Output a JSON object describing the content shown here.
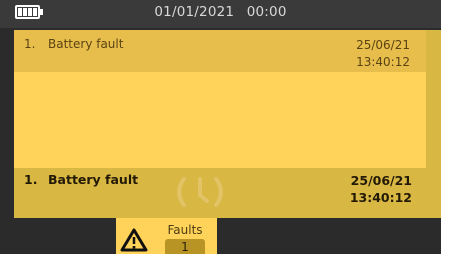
{
  "status_bar": {
    "battery_icon": "battery-full-icon",
    "date": "01/01/2021",
    "time": "00:00"
  },
  "fault_list": {
    "items": [
      {
        "number": "1.",
        "label": "Battery fault",
        "date": "25/06/21",
        "time": "13:40:12"
      }
    ]
  },
  "fault_detail": {
    "number": "1.",
    "label": "Battery fault",
    "date": "25/06/21",
    "time": "13:40:12"
  },
  "footer": {
    "tab": {
      "icon": "warning-triangle-icon",
      "label": "Faults",
      "count": "1"
    }
  },
  "navigation": {
    "next_icon": "chevron-left-icon"
  },
  "colors": {
    "accent": "#ffd35a",
    "panel": "#d8b743",
    "selected_row": "#e7bd4c",
    "background": "#2b2b2b"
  }
}
